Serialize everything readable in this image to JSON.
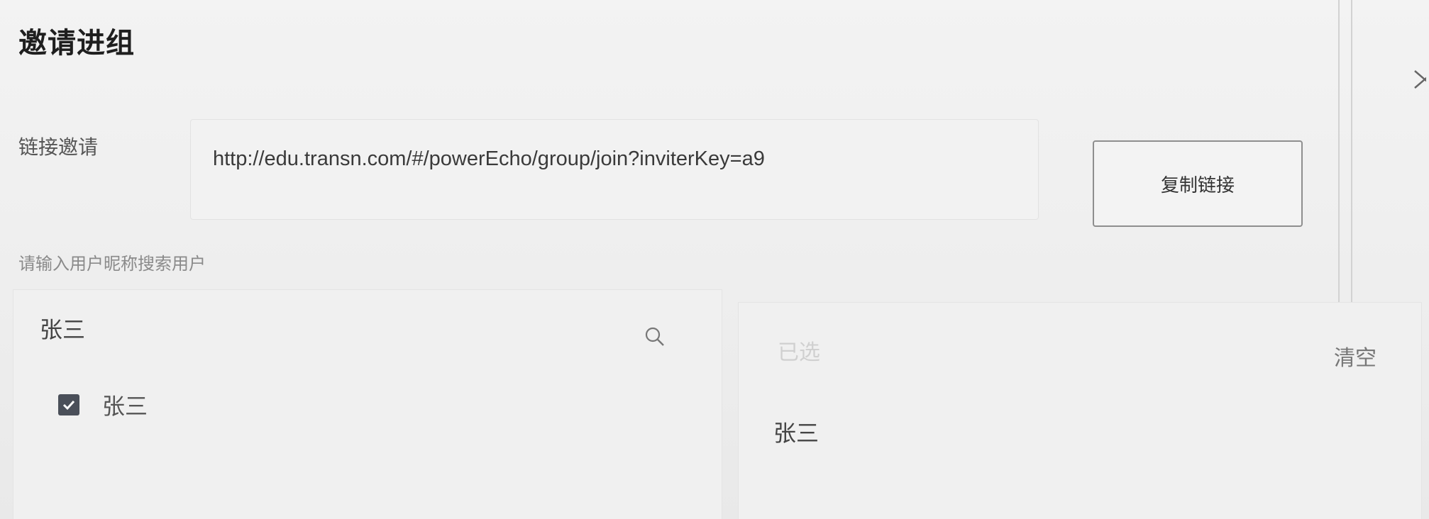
{
  "dialog": {
    "title": "邀请进组",
    "close_icon": "close-icon"
  },
  "link": {
    "label": "链接邀请",
    "url": "http://edu.transn.com/#/powerEcho/group/join?inviterKey=a9",
    "copy_button": "复制链接"
  },
  "search": {
    "hint": "请输入用户昵称搜索用户",
    "value": "张三",
    "icon": "search-icon"
  },
  "results": {
    "items": [
      {
        "label": "张三",
        "checked": true
      }
    ]
  },
  "selected": {
    "header": "已选",
    "clear": "清空",
    "items": [
      {
        "label": "张三"
      }
    ]
  }
}
